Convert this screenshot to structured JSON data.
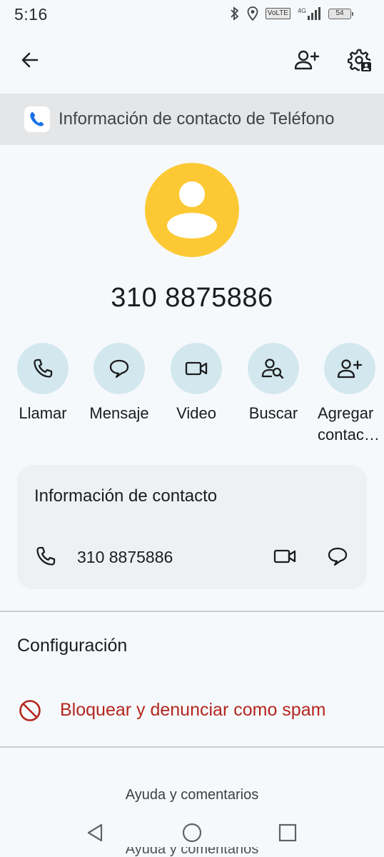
{
  "status_bar": {
    "time": "5:16",
    "network": "4G",
    "volte": "VoLTE",
    "battery": "54"
  },
  "banner": {
    "text": "Información de contacto de Teléfono"
  },
  "contact": {
    "number": "310 8875886",
    "avatar_color": "#fcc934"
  },
  "actions": [
    {
      "label": "Llamar",
      "icon": "phone-icon"
    },
    {
      "label": "Mensaje",
      "icon": "message-icon"
    },
    {
      "label": "Video",
      "icon": "video-icon"
    },
    {
      "label": "Buscar",
      "icon": "person-search-icon"
    },
    {
      "label": "Agregar contac…",
      "icon": "person-add-icon"
    }
  ],
  "info_card": {
    "title": "Información de contacto",
    "number": "310 8875886"
  },
  "settings": {
    "title": "Configuración",
    "block_label": "Bloquear y denunciar como spam",
    "block_color": "#b3261e"
  },
  "footer": {
    "help": "Ayuda y comentarios"
  },
  "colors": {
    "background": "#f6f9fc",
    "action_circle": "#d3e8ee",
    "card": "#eef1f4",
    "banner": "#e4e6e8"
  }
}
